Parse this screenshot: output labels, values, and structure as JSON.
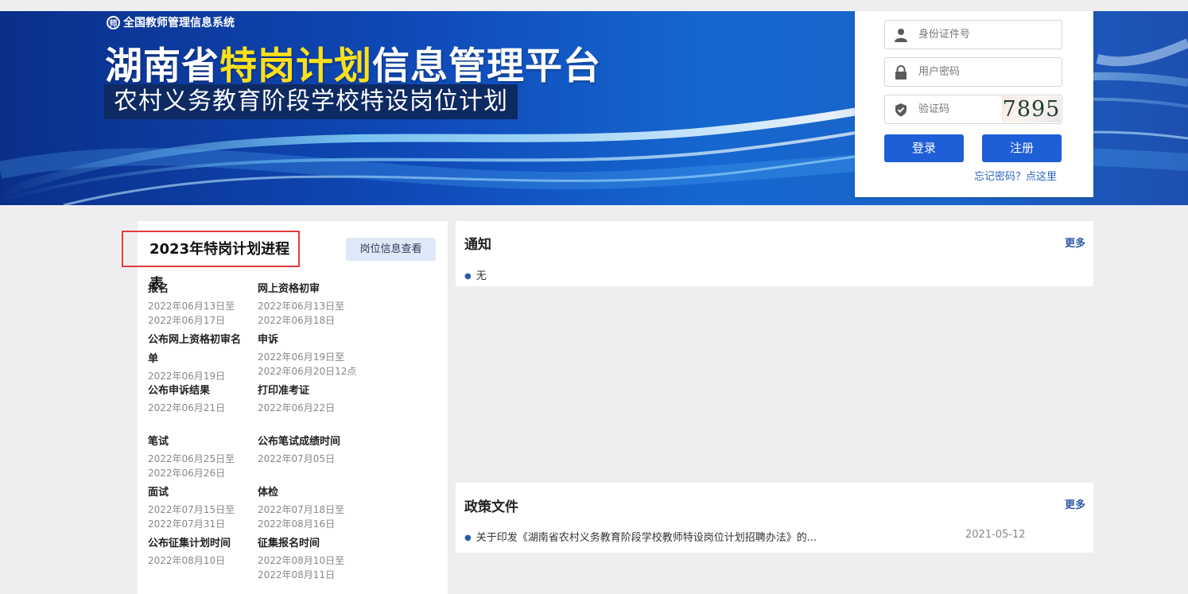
{
  "banner": {
    "system_title": "全国教师管理信息系统",
    "title_prefix": "湖南省",
    "title_highlight": "特岗计划",
    "title_suffix": "信息管理平台",
    "subtitle": "农村义务教育阶段学校特设岗位计划"
  },
  "login": {
    "id_placeholder": "身份证件号",
    "password_placeholder": "用户密码",
    "captcha_placeholder": "验证码",
    "captcha_value": "7895",
    "login_label": "登录",
    "register_label": "注册",
    "forgot_label": "忘记密码？点这里"
  },
  "progress": {
    "title": "2023年特岗计划进程表",
    "view_button": "岗位信息查看",
    "stages": [
      {
        "name": "报名",
        "d1": "2022年06月13日至",
        "d2": "2022年06月17日"
      },
      {
        "name": "网上资格初审",
        "d1": "2022年06月13日至",
        "d2": "2022年06月18日"
      },
      {
        "name": "公布网上资格初审名",
        "name2": "单",
        "d1": "2022年06月19日",
        "d2": ""
      },
      {
        "name": "申诉",
        "d1": "2022年06月19日至",
        "d2": "2022年06月20日12点"
      },
      {
        "name": "公布申诉结果",
        "d1": "2022年06月21日",
        "d2": ""
      },
      {
        "name": "打印准考证",
        "d1": "2022年06月22日",
        "d2": ""
      },
      {
        "name": "笔试",
        "d1": "2022年06月25日至",
        "d2": "2022年06月26日"
      },
      {
        "name": "公布笔试成绩时间",
        "d1": "2022年07月05日",
        "d2": ""
      },
      {
        "name": "面试",
        "d1": "2022年07月15日至",
        "d2": "2022年07月31日"
      },
      {
        "name": "体检",
        "d1": "2022年07月18日至",
        "d2": "2022年08月16日"
      },
      {
        "name": "公布征集计划时间",
        "d1": "2022年08月10日",
        "d2": ""
      },
      {
        "name": "征集报名时间",
        "d1": "2022年08月10日至",
        "d2": "2022年08月11日"
      }
    ]
  },
  "notice": {
    "title": "通知",
    "more": "更多",
    "items": [
      {
        "text": "无"
      }
    ]
  },
  "policy": {
    "title": "政策文件",
    "more": "更多",
    "items": [
      {
        "text": "关于印发《湖南省农村义务教育阶段学校教师特设岗位计划招聘办法》的...",
        "date": "2021-05-12"
      }
    ]
  },
  "colors": {
    "accent": "#1e5ed6",
    "highlight_yellow": "#ffe01a",
    "frame_red": "#e33c3c",
    "link_blue": "#2b5aa8"
  }
}
